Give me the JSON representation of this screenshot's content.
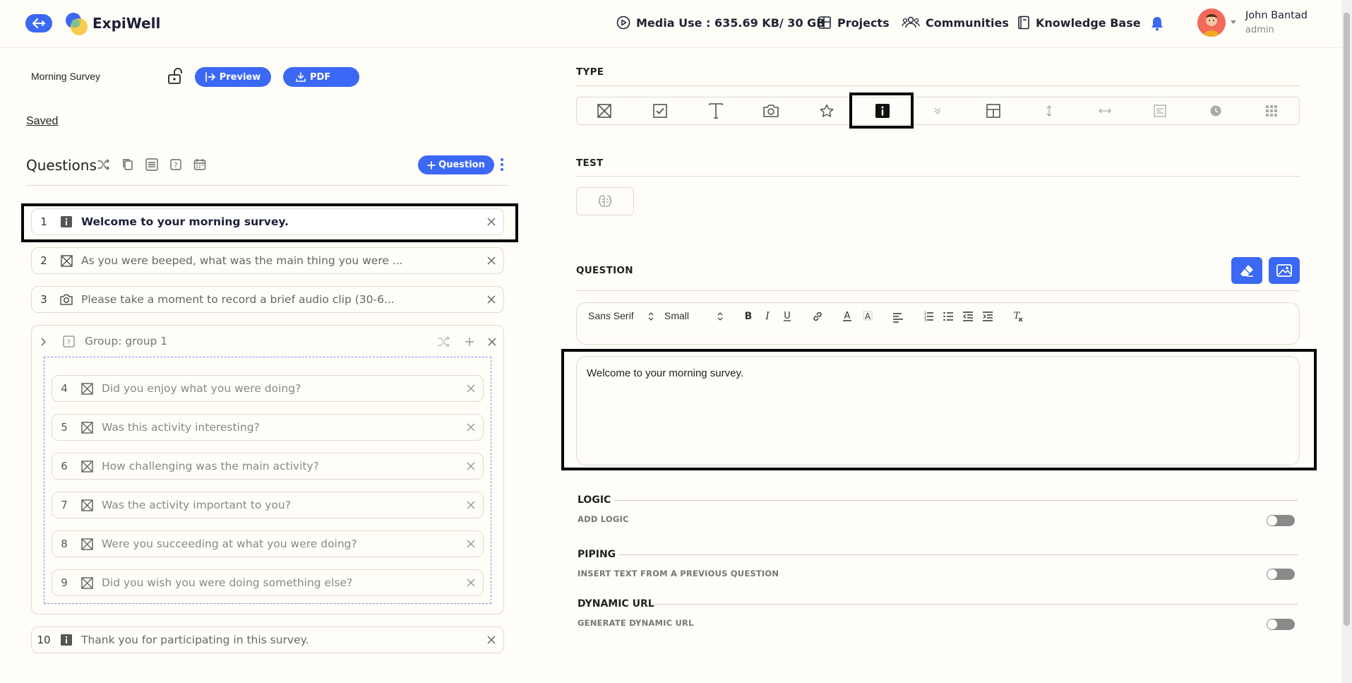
{
  "header": {
    "app_name": "ExpiWell",
    "media_use": "Media Use : 635.69 KB/ 30 GB",
    "projects": "Projects",
    "communities": "Communities",
    "knowledge_base": "Knowledge Base",
    "user_name": "John Bantad",
    "user_role": "admin"
  },
  "survey": {
    "name": "Morning Survey",
    "preview_label": "Preview",
    "pdf_label": "PDF",
    "save_status": "Saved"
  },
  "questions_panel": {
    "heading": "Questions",
    "add_label": "Question"
  },
  "questions": [
    {
      "num": "1",
      "type": "info",
      "text": "Welcome to your morning survey."
    },
    {
      "num": "2",
      "type": "choice",
      "text": "As you were beeped, what was the main thing you were ..."
    },
    {
      "num": "3",
      "type": "photo",
      "text": "Please take a moment to record a brief audio clip (30-6..."
    },
    {
      "num": "10",
      "type": "info",
      "text": "Thank you for participating in this survey."
    }
  ],
  "group": {
    "label": "Group: group 1",
    "items": [
      {
        "num": "4",
        "text": "Did you enjoy what you were doing?"
      },
      {
        "num": "5",
        "text": "Was this activity interesting?"
      },
      {
        "num": "6",
        "text": "How challenging was the main activity?"
      },
      {
        "num": "7",
        "text": "Was the activity important to you?"
      },
      {
        "num": "8",
        "text": "Were you succeeding at what you were doing?"
      },
      {
        "num": "9",
        "text": "Did you wish you were doing something else?"
      }
    ]
  },
  "editor_panel": {
    "type_label": "TYPE",
    "test_label": "TEST",
    "question_label": "QUESTION",
    "font_family": "Sans Serif",
    "font_size": "Small",
    "content": "Welcome to your morning survey."
  },
  "options": {
    "logic_title": "LOGIC",
    "logic_sub": "ADD LOGIC",
    "piping_title": "PIPING",
    "piping_sub": "INSERT TEXT FROM A PREVIOUS QUESTION",
    "dynamic_title": "DYNAMIC URL",
    "dynamic_sub": "GENERATE DYNAMIC URL"
  },
  "colors": {
    "accent": "#3b68f5",
    "background": "#fffdf7"
  }
}
